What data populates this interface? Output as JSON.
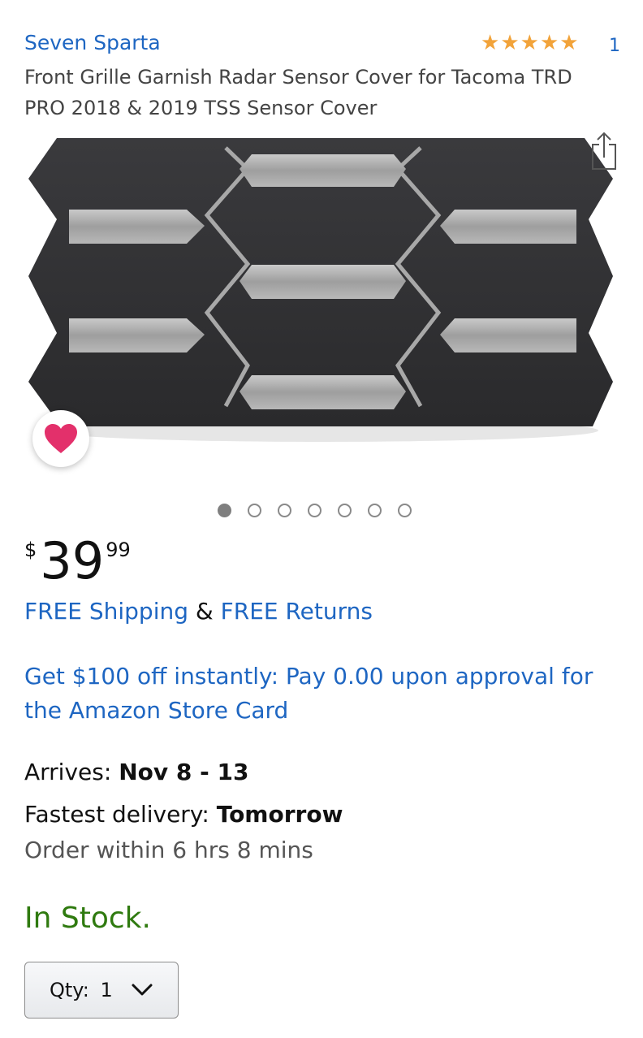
{
  "brand": "Seven Sparta",
  "rating": {
    "stars": 5,
    "count": "1"
  },
  "title": "Front Grille Garnish Radar Sensor Cover for Tacoma TRD PRO 2018 & 2019 TSS Sensor Cover",
  "icons": {
    "share": "share-icon",
    "favorite": "heart-icon",
    "dropdown": "chevron-down-icon",
    "star": "star-icon"
  },
  "colors": {
    "link": "#1e66c2",
    "star": "#f2a33a",
    "heart": "#e3306b",
    "in_stock": "#2f7a0f"
  },
  "carousel": {
    "total": 7,
    "active_index": 0
  },
  "price": {
    "symbol": "$",
    "whole": "39",
    "fraction": "99"
  },
  "shipping": {
    "free_shipping": "FREE Shipping",
    "amp": " & ",
    "free_returns": "FREE Returns"
  },
  "promo": "Get $100 off instantly: Pay 0.00 upon approval for the Amazon Store Card",
  "delivery": {
    "arrives_label": "Arrives: ",
    "arrives_value": "Nov 8 - 13",
    "fastest_label": "Fastest delivery: ",
    "fastest_value": "Tomorrow",
    "order_within": "Order within 6 hrs 8 mins"
  },
  "stock": "In Stock.",
  "qty": {
    "label": "Qty: ",
    "value": "1"
  }
}
